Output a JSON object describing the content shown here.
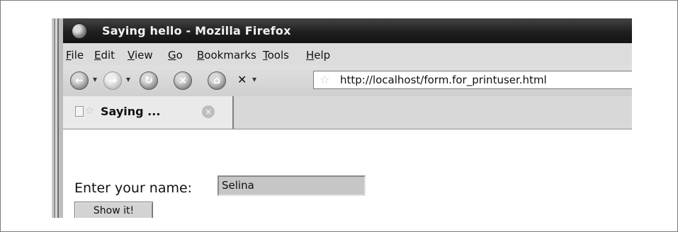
{
  "window": {
    "title": "Saying hello - Mozilla Firefox"
  },
  "menubar": {
    "items": [
      {
        "prefix": "",
        "accel": "F",
        "rest": "ile"
      },
      {
        "prefix": "",
        "accel": "E",
        "rest": "dit"
      },
      {
        "prefix": "",
        "accel": "V",
        "rest": "iew"
      },
      {
        "prefix": "",
        "accel": "G",
        "rest": "o"
      },
      {
        "prefix": "",
        "accel": "B",
        "rest": "ookmarks"
      },
      {
        "prefix": "",
        "accel": "T",
        "rest": "ools"
      },
      {
        "prefix": "",
        "accel": "H",
        "rest": "elp"
      }
    ]
  },
  "navbar": {
    "url": "http://localhost/form.for_printuser.html"
  },
  "tab": {
    "label": "Saying ..."
  },
  "page": {
    "prompt": "Enter your name:",
    "name_value": "Selina",
    "button_label": "Show it!"
  },
  "icons": {
    "app": "firefox-icon",
    "back": "back-icon",
    "forward": "forward-icon",
    "reload": "reload-icon",
    "stop": "stop-icon",
    "home": "home-icon",
    "feed": "feed-icon",
    "bookmark": "star-icon",
    "page": "page-icon",
    "close_tab": "close-tab-icon"
  }
}
